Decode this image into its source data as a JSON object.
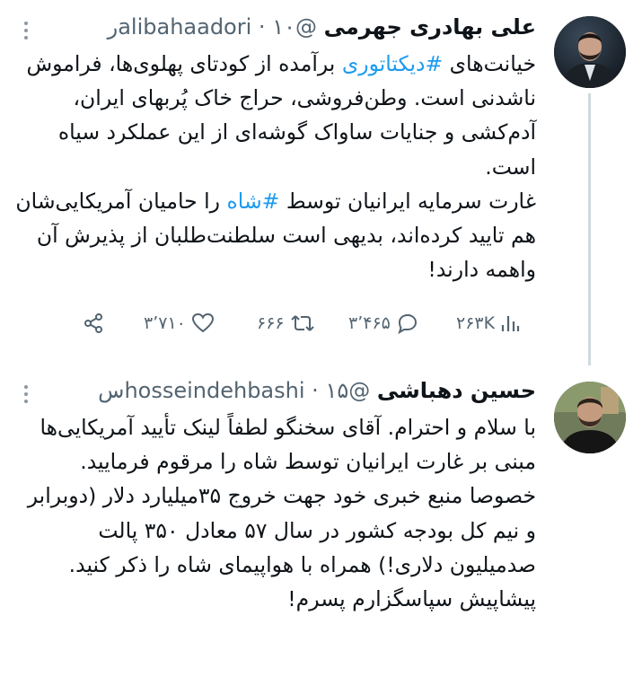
{
  "tweets": [
    {
      "name": "علی بهادری جهرمی",
      "handle": "@alibahaadori",
      "dot": "·",
      "time": "۱۰ر",
      "paragraphs": [
        [
          {
            "t": "خیانت‌های "
          },
          {
            "t": "#دیکتاتوری",
            "tag": true
          },
          {
            "t": " برآمده از کودتای پهلوی‌ها، فراموش ناشدنی است. وطن‌فروشی، حراج خاک پُربهای ایران، آدم‌کشی و جنایات ساواک گوشه‌ای از این عملکرد سیاه است."
          }
        ],
        [
          {
            "t": "غارت سرمایه ایرانیان توسط "
          },
          {
            "t": "#شاه",
            "tag": true
          },
          {
            "t": " را حامیان آمریکایی‌شان هم تایید کرده‌اند، بدیهی است سلطنت‌طلبان از پذیرش آن واهمه دارند!"
          }
        ]
      ],
      "stats": {
        "views": "۲۶۳K",
        "replies": "۳٬۴۶۵",
        "retweets": "۶۶۶",
        "likes": "۳٬۷۱۰"
      }
    },
    {
      "name": "حسین دهباشی",
      "handle": "@hosseindehbashi",
      "dot": "·",
      "time": "۱۵س",
      "paragraphs": [
        [
          {
            "t": "با سلام و احترام. آقای سخنگو لطفاً لینک تأیید آمریکایی‌ها مبنی بر غارت ایرانیان توسط شاه را مرقوم فرمایید. خصوصا منبع خبری خود جهت خروج ۳۵میلیارد دلار (دوبرابر و نیم کل بودجه کشور در سال ۵۷ معادل ۳۵۰ پالت صدمیلیون دلاری!) همراه با هواپیمای شاه را ذکر کنید. پیشاپیش سپاسگزارم پسرم!"
          }
        ]
      ]
    }
  ]
}
